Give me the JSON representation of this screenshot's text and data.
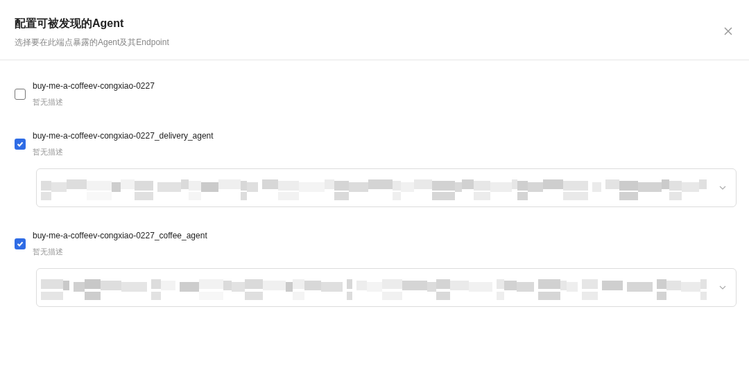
{
  "dialog": {
    "title": "配置可被发现的Agent",
    "subtitle": "选择要在此端点暴露的Agent及其Endpoint"
  },
  "agents": [
    {
      "name": "buy-me-a-coffeev-congxiao-0227",
      "description": "暂无描述",
      "checked": false
    },
    {
      "name": "buy-me-a-coffeev-congxiao-0227_delivery_agent",
      "description": "暂无描述",
      "checked": true,
      "endpoint_select": {
        "value_obscured": true
      }
    },
    {
      "name": "buy-me-a-coffeev-congxiao-0227_coffee_agent",
      "description": "暂无描述",
      "checked": true,
      "endpoint_select": {
        "value_obscured": true
      }
    }
  ]
}
